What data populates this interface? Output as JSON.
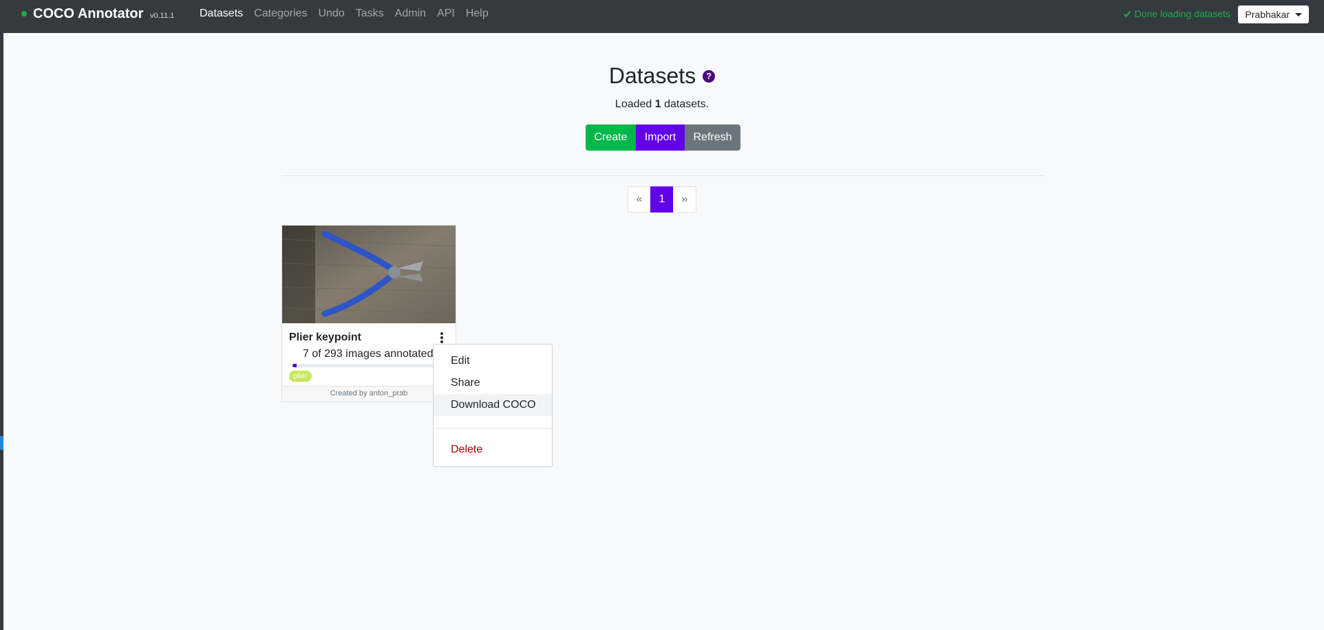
{
  "navbar": {
    "brand": "COCO Annotator",
    "version": "v0.11.1",
    "links": [
      "Datasets",
      "Categories",
      "Undo",
      "Tasks",
      "Admin",
      "API",
      "Help"
    ],
    "active_link": "Datasets",
    "status": "Done loading datasets",
    "user": "Prabhakar"
  },
  "page": {
    "title": "Datasets",
    "help_glyph": "?",
    "loaded_prefix": "Loaded",
    "loaded_count": "1",
    "loaded_suffix": "datasets."
  },
  "actions": {
    "create": "Create",
    "import": "Import",
    "refresh": "Refresh",
    "colors": {
      "create": "#00b74a",
      "import": "#6200ea",
      "refresh": "#6c757d"
    }
  },
  "pagination": {
    "prev": "«",
    "current": "1",
    "next": "»"
  },
  "dataset_card": {
    "name": "Plier keypoint",
    "progress_text": "7 of 293 images annotated",
    "annotated": 7,
    "total": 293,
    "tag": "plier",
    "created_by": "Created by anton_prab"
  },
  "menu": {
    "items": [
      "Edit",
      "Share",
      "Download COCO"
    ],
    "hovered": "Download COCO",
    "delete": "Delete"
  }
}
